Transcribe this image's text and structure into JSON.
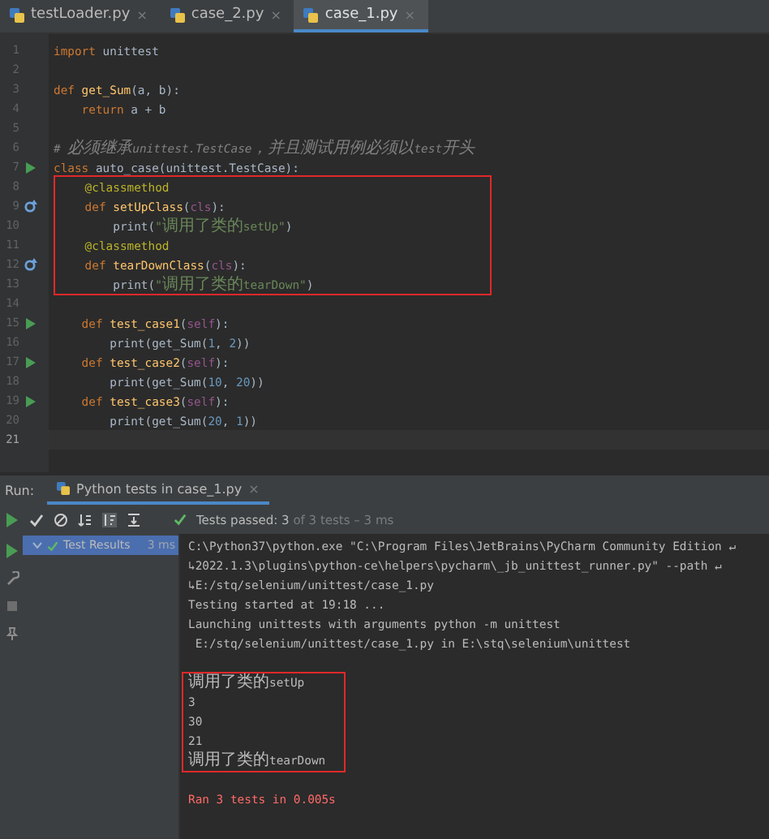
{
  "tabs": [
    {
      "label": "testLoader.py",
      "close": "×",
      "selected": false
    },
    {
      "label": "case_2.py",
      "close": "×",
      "selected": false
    },
    {
      "label": "case_1.py",
      "close": "×",
      "selected": true
    }
  ],
  "editor": {
    "lines": [
      {
        "number": "1",
        "kind": "plain",
        "boxed": false,
        "tokens": [
          {
            "kind": "keyword",
            "text": "import"
          },
          {
            "kind": "plain",
            "text": " unittest"
          }
        ]
      },
      {
        "number": "2",
        "kind": "plain"
      },
      {
        "number": "3",
        "kind": "plain",
        "boxed": false,
        "tokens": [
          {
            "kind": "keyword",
            "text": "def"
          },
          {
            "kind": "function",
            "text": " get_Sum"
          },
          {
            "kind": "plain",
            "text": "(a, b):"
          }
        ]
      },
      {
        "number": "4",
        "kind": "plain",
        "boxed": false,
        "tokens": [
          {
            "kind": "keyword",
            "text": "    return"
          },
          {
            "kind": "plain",
            "text": " a + b"
          }
        ]
      },
      {
        "number": "5",
        "kind": "plain"
      },
      {
        "number": "6",
        "kind": "plain",
        "boxed": false,
        "tokens": [
          {
            "kind": "comment",
            "text": "# 必须继承unittest.TestCase，并且测试用例必须以test开头"
          }
        ]
      },
      {
        "number": "7",
        "kind": "run",
        "boxed": false,
        "tokens": [
          {
            "kind": "keyword",
            "text": "class"
          },
          {
            "kind": "plain",
            "text": " auto_case(unittest.TestCase):"
          }
        ]
      },
      {
        "number": "8",
        "kind": "plain",
        "boxed": true,
        "tokens": [
          {
            "kind": "decorator",
            "text": "    @classmethod"
          }
        ]
      },
      {
        "number": "9",
        "kind": "override",
        "boxed": true,
        "tokens": [
          {
            "kind": "keyword",
            "text": "    def"
          },
          {
            "kind": "function",
            "text": " setUpClass"
          },
          {
            "kind": "plain",
            "text": "("
          },
          {
            "kind": "self",
            "text": "cls"
          },
          {
            "kind": "plain",
            "text": "):"
          }
        ]
      },
      {
        "number": "10",
        "kind": "plain",
        "boxed": true,
        "tokens": [
          {
            "kind": "plain",
            "text": "        print("
          },
          {
            "kind": "string",
            "text": "\"调用了类的setUp\""
          },
          {
            "kind": "plain",
            "text": ")"
          }
        ]
      },
      {
        "number": "11",
        "kind": "plain",
        "boxed": true,
        "tokens": [
          {
            "kind": "decorator",
            "text": "    @classmethod"
          }
        ]
      },
      {
        "number": "12",
        "kind": "override",
        "boxed": true,
        "tokens": [
          {
            "kind": "keyword",
            "text": "    def"
          },
          {
            "kind": "function",
            "text": " tearDownClass"
          },
          {
            "kind": "plain",
            "text": "("
          },
          {
            "kind": "self",
            "text": "cls"
          },
          {
            "kind": "plain",
            "text": "):"
          }
        ]
      },
      {
        "number": "13",
        "kind": "plain",
        "boxed": true,
        "tokens": [
          {
            "kind": "plain",
            "text": "        print("
          },
          {
            "kind": "string",
            "text": "\"调用了类的tearDown\""
          },
          {
            "kind": "plain",
            "text": ")"
          }
        ]
      },
      {
        "number": "14",
        "kind": "plain"
      },
      {
        "number": "15",
        "kind": "run",
        "boxed": false,
        "tokens": [
          {
            "kind": "keyword",
            "text": "    def"
          },
          {
            "kind": "function",
            "text": " test_case1"
          },
          {
            "kind": "plain",
            "text": "("
          },
          {
            "kind": "self",
            "text": "self"
          },
          {
            "kind": "plain",
            "text": "):"
          }
        ]
      },
      {
        "number": "16",
        "kind": "plain",
        "boxed": false,
        "tokens": [
          {
            "kind": "plain",
            "text": "        print(get_Sum("
          },
          {
            "kind": "number",
            "text": "1"
          },
          {
            "kind": "plain",
            "text": ", "
          },
          {
            "kind": "number",
            "text": "2"
          },
          {
            "kind": "plain",
            "text": "))"
          }
        ]
      },
      {
        "number": "17",
        "kind": "run",
        "boxed": false,
        "tokens": [
          {
            "kind": "keyword",
            "text": "    def"
          },
          {
            "kind": "function",
            "text": " test_case2"
          },
          {
            "kind": "plain",
            "text": "("
          },
          {
            "kind": "self",
            "text": "self"
          },
          {
            "kind": "plain",
            "text": "):"
          }
        ]
      },
      {
        "number": "18",
        "kind": "plain",
        "boxed": false,
        "tokens": [
          {
            "kind": "plain",
            "text": "        print(get_Sum("
          },
          {
            "kind": "number",
            "text": "10"
          },
          {
            "kind": "plain",
            "text": ", "
          },
          {
            "kind": "number",
            "text": "20"
          },
          {
            "kind": "plain",
            "text": "))"
          }
        ]
      },
      {
        "number": "19",
        "kind": "run",
        "boxed": false,
        "tokens": [
          {
            "kind": "keyword",
            "text": "    def"
          },
          {
            "kind": "function",
            "text": " test_case3"
          },
          {
            "kind": "plain",
            "text": "("
          },
          {
            "kind": "self",
            "text": "self"
          },
          {
            "kind": "plain",
            "text": "):"
          }
        ]
      },
      {
        "number": "20",
        "kind": "plain",
        "boxed": false,
        "tokens": [
          {
            "kind": "plain",
            "text": "        print(get_Sum("
          },
          {
            "kind": "number",
            "text": "20"
          },
          {
            "kind": "plain",
            "text": ", "
          },
          {
            "kind": "number",
            "text": "1"
          },
          {
            "kind": "plain",
            "text": "))"
          }
        ]
      },
      {
        "number": "21",
        "kind": "plain",
        "current": true
      }
    ]
  },
  "run_panel": {
    "label": "Run:",
    "tab": {
      "label": "Python tests in case_1.py",
      "close": "×",
      "selected": true
    },
    "status": {
      "label": "Tests passed: 3",
      "detail": "of 3 tests – 3 ms"
    },
    "tree": [
      {
        "label": "Test Results",
        "time": "3 ms",
        "selected": true
      }
    ],
    "console": [
      {
        "kind": "plain",
        "boxed": false,
        "text": "C:\\Python37\\python.exe \"C:\\Program Files\\JetBrains\\PyCharm Community Edition ↵"
      },
      {
        "kind": "plain",
        "boxed": false,
        "text": "↳2022.1.3\\plugins\\python-ce\\helpers\\pycharm\\_jb_unittest_runner.py\" --path ↵"
      },
      {
        "kind": "plain",
        "boxed": false,
        "text": "↳E:/stq/selenium/unittest/case_1.py"
      },
      {
        "kind": "plain",
        "boxed": false,
        "text": "Testing started at 19:18 ..."
      },
      {
        "kind": "plain",
        "boxed": false,
        "text": "Launching unittests with arguments python -m unittest"
      },
      {
        "kind": "plain",
        "boxed": false,
        "text": " E:/stq/selenium/unittest/case_1.py in E:\\stq\\selenium\\unittest"
      },
      {
        "kind": "blank"
      },
      {
        "kind": "plain",
        "boxed": true,
        "text": "调用了类的setUp"
      },
      {
        "kind": "plain",
        "boxed": true,
        "text": "3"
      },
      {
        "kind": "plain",
        "boxed": true,
        "text": "30"
      },
      {
        "kind": "plain",
        "boxed": true,
        "text": "21"
      },
      {
        "kind": "plain",
        "boxed": true,
        "text": "调用了类的tearDown"
      },
      {
        "kind": "blank"
      },
      {
        "kind": "error",
        "boxed": false,
        "text": "Ran 3 tests in 0.005s"
      }
    ]
  }
}
